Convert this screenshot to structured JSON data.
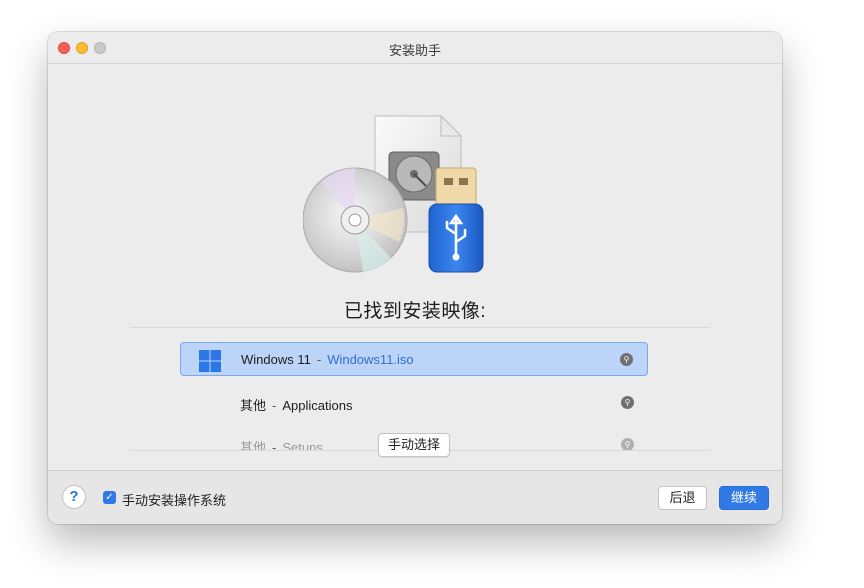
{
  "window": {
    "title": "安装助手"
  },
  "heading": "已找到安装映像:",
  "images": [
    {
      "name": "Windows 11",
      "separator": "-",
      "detail": "Windows11.iso",
      "icon": "windows-icon",
      "selected": true
    },
    {
      "name": "其他",
      "separator": "-",
      "detail": "Applications",
      "icon": "",
      "selected": false
    },
    {
      "name": "其他",
      "separator": "-",
      "detail": "Setups",
      "icon": "",
      "selected": false
    }
  ],
  "icons": {
    "hero": [
      "optical-disc-icon",
      "disk-image-icon",
      "usb-drive-icon"
    ],
    "reveal": "magnifier-icon",
    "help": "question-icon",
    "check": "checkmark-icon"
  },
  "manual_select_label": "手动选择",
  "footer": {
    "help_label": "?",
    "manual_install_label": "手动安装操作系统",
    "manual_install_checked": true,
    "back_label": "后退",
    "continue_label": "继续"
  },
  "colors": {
    "accent": "#2f7ae5",
    "selection": "#bcd4f7",
    "link": "#2f6fd8"
  }
}
